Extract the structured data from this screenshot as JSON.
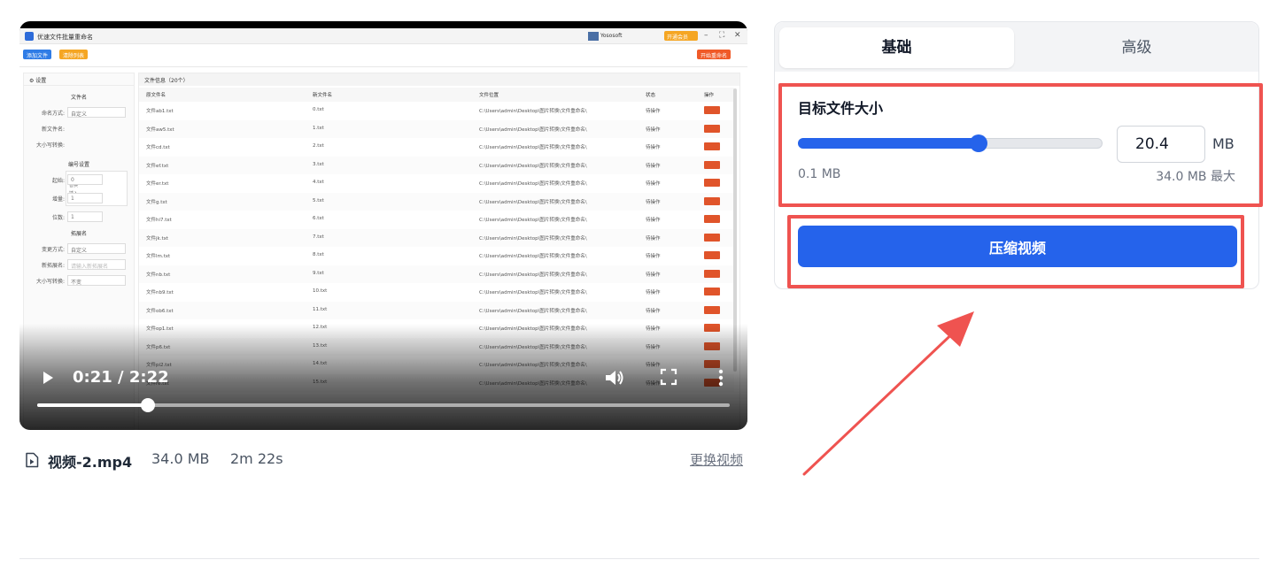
{
  "video_frame": {
    "app_title": "优速文件批量重命名",
    "user_name": "Yososoft",
    "vip_badge": "开通会员",
    "toolbar": {
      "add_file": "添加文件",
      "clear_list": "清除列表",
      "start": "开始重命名"
    },
    "settings_header": "设置",
    "file_list_header": "文件信息（20个）",
    "sections": {
      "filename": "文件名",
      "numbering": "编号设置",
      "extension": "拓展名"
    },
    "fields": {
      "naming_mode": {
        "label": "命名方式:",
        "value": "自定义"
      },
      "new_filename": {
        "label": "新文件名:",
        "value": ""
      },
      "case_convert": {
        "label": "大小写转换:",
        "value": ""
      },
      "start": {
        "label": "起始:",
        "value": "0"
      },
      "increment": {
        "label": "增量:",
        "value": "1"
      },
      "digits": {
        "label": "位数:",
        "value": "1"
      },
      "ext_mode": {
        "label": "变更方式:",
        "value": "自定义"
      },
      "new_ext": {
        "label": "新拓展名:",
        "value": "请输入新拓展名"
      },
      "ext_case": {
        "label": "大小写转换:",
        "value": "不变"
      }
    },
    "dropdown_options": [
      "自定义",
      "替换",
      "插入"
    ],
    "columns": [
      "原文件名",
      "新文件名",
      "文件位置",
      "状态",
      "操作"
    ],
    "rows": [
      [
        "文件ab1.txt",
        "0.txt",
        "C:\\Users\\admin\\Desktop\\图片转换\\文件重命名\\",
        "待操作"
      ],
      [
        "文件aw5.txt",
        "1.txt",
        "C:\\Users\\admin\\Desktop\\图片转换\\文件重命名\\",
        "待操作"
      ],
      [
        "文件cd.txt",
        "2.txt",
        "C:\\Users\\admin\\Desktop\\图片转换\\文件重命名\\",
        "待操作"
      ],
      [
        "文件ef.txt",
        "3.txt",
        "C:\\Users\\admin\\Desktop\\图片转换\\文件重命名\\",
        "待操作"
      ],
      [
        "文件er.txt",
        "4.txt",
        "C:\\Users\\admin\\Desktop\\图片转换\\文件重命名\\",
        "待操作"
      ],
      [
        "文件g.txt",
        "5.txt",
        "C:\\Users\\admin\\Desktop\\图片转换\\文件重命名\\",
        "待操作"
      ],
      [
        "文件hi7.txt",
        "6.txt",
        "C:\\Users\\admin\\Desktop\\图片转换\\文件重命名\\",
        "待操作"
      ],
      [
        "文件jk.txt",
        "7.txt",
        "C:\\Users\\admin\\Desktop\\图片转换\\文件重命名\\",
        "待操作"
      ],
      [
        "文件lm.txt",
        "8.txt",
        "C:\\Users\\admin\\Desktop\\图片转换\\文件重命名\\",
        "待操作"
      ],
      [
        "文件nb.txt",
        "9.txt",
        "C:\\Users\\admin\\Desktop\\图片转换\\文件重命名\\",
        "待操作"
      ],
      [
        "文件nb9.txt",
        "10.txt",
        "C:\\Users\\admin\\Desktop\\图片转换\\文件重命名\\",
        "待操作"
      ],
      [
        "文件ob6.txt",
        "11.txt",
        "C:\\Users\\admin\\Desktop\\图片转换\\文件重命名\\",
        "待操作"
      ],
      [
        "文件op1.txt",
        "12.txt",
        "C:\\Users\\admin\\Desktop\\图片转换\\文件重命名\\",
        "待操作"
      ],
      [
        "文件p6.txt",
        "13.txt",
        "C:\\Users\\admin\\Desktop\\图片转换\\文件重命名\\",
        "待操作"
      ],
      [
        "文件pi2.txt",
        "14.txt",
        "C:\\Users\\admin\\Desktop\\图片转换\\文件重命名\\",
        "待操作"
      ],
      [
        "文件re.txt",
        "15.txt",
        "C:\\Users\\admin\\Desktop\\图片转换\\文件重命名\\",
        "待操作"
      ]
    ],
    "delete_label": "删除"
  },
  "player": {
    "time_display": "0:21 / 2:22",
    "progress_fraction": 0.16,
    "icons": {
      "play": "play-icon",
      "volume": "volume-icon",
      "fullscreen": "fullscreen-icon",
      "more": "more-vertical-icon"
    }
  },
  "file": {
    "icon": "video-file-icon",
    "name": "视频-2.mp4",
    "size": "34.0 MB",
    "duration": "2m 22s",
    "replace_label": "更换视频"
  },
  "settings": {
    "tabs": [
      {
        "label": "基础",
        "active": true
      },
      {
        "label": "高级",
        "active": false
      }
    ],
    "target_size_label": "目标文件大小",
    "target_value": "20.4",
    "unit": "MB",
    "min_label": "0.1 MB",
    "max_label": "34.0 MB 最大",
    "slider_fraction": 0.595,
    "compress_label": "压缩视频"
  },
  "colors": {
    "accent": "#2563eb",
    "highlight": "#ef5350",
    "frame_orange": "#f05a28"
  }
}
